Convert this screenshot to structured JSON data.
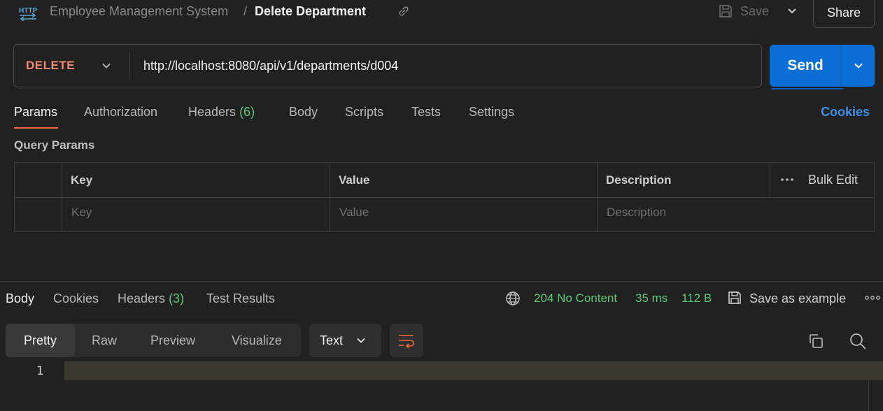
{
  "header": {
    "http_icon": "http-icon",
    "breadcrumb_parent": "Employee Management System",
    "breadcrumb_sep": "/",
    "title": "Delete Department",
    "save_label": "Save",
    "share_label": "Share"
  },
  "request": {
    "method": "DELETE",
    "url": "http://localhost:8080/api/v1/departments/d004",
    "send_label": "Send"
  },
  "request_tabs": {
    "params": "Params",
    "authorization": "Authorization",
    "headers": "Headers",
    "headers_count": "(6)",
    "body": "Body",
    "scripts": "Scripts",
    "tests": "Tests",
    "settings": "Settings",
    "cookies": "Cookies",
    "active": "Params"
  },
  "query_params": {
    "title": "Query Params",
    "columns": [
      "Key",
      "Value",
      "Description"
    ],
    "bulk_edit": "Bulk Edit",
    "placeholders": [
      "Key",
      "Value",
      "Description"
    ]
  },
  "response": {
    "tabs": {
      "body": "Body",
      "cookies": "Cookies",
      "headers": "Headers",
      "headers_count": "(3)",
      "test_results": "Test Results",
      "active": "Body"
    },
    "status": "204 No Content",
    "time": "35 ms",
    "size": "112 B",
    "save_example": "Save as example",
    "views": [
      "Pretty",
      "Raw",
      "Preview",
      "Visualize"
    ],
    "active_view": "Pretty",
    "format": "Text",
    "line_numbers": [
      "1"
    ]
  },
  "colors": {
    "accent_send": "#0b6fd6",
    "method_delete": "#f08c76",
    "status_green": "#5cc97a",
    "tab_underline": "#f26b3a",
    "cookies_link": "#3d8fe6"
  }
}
